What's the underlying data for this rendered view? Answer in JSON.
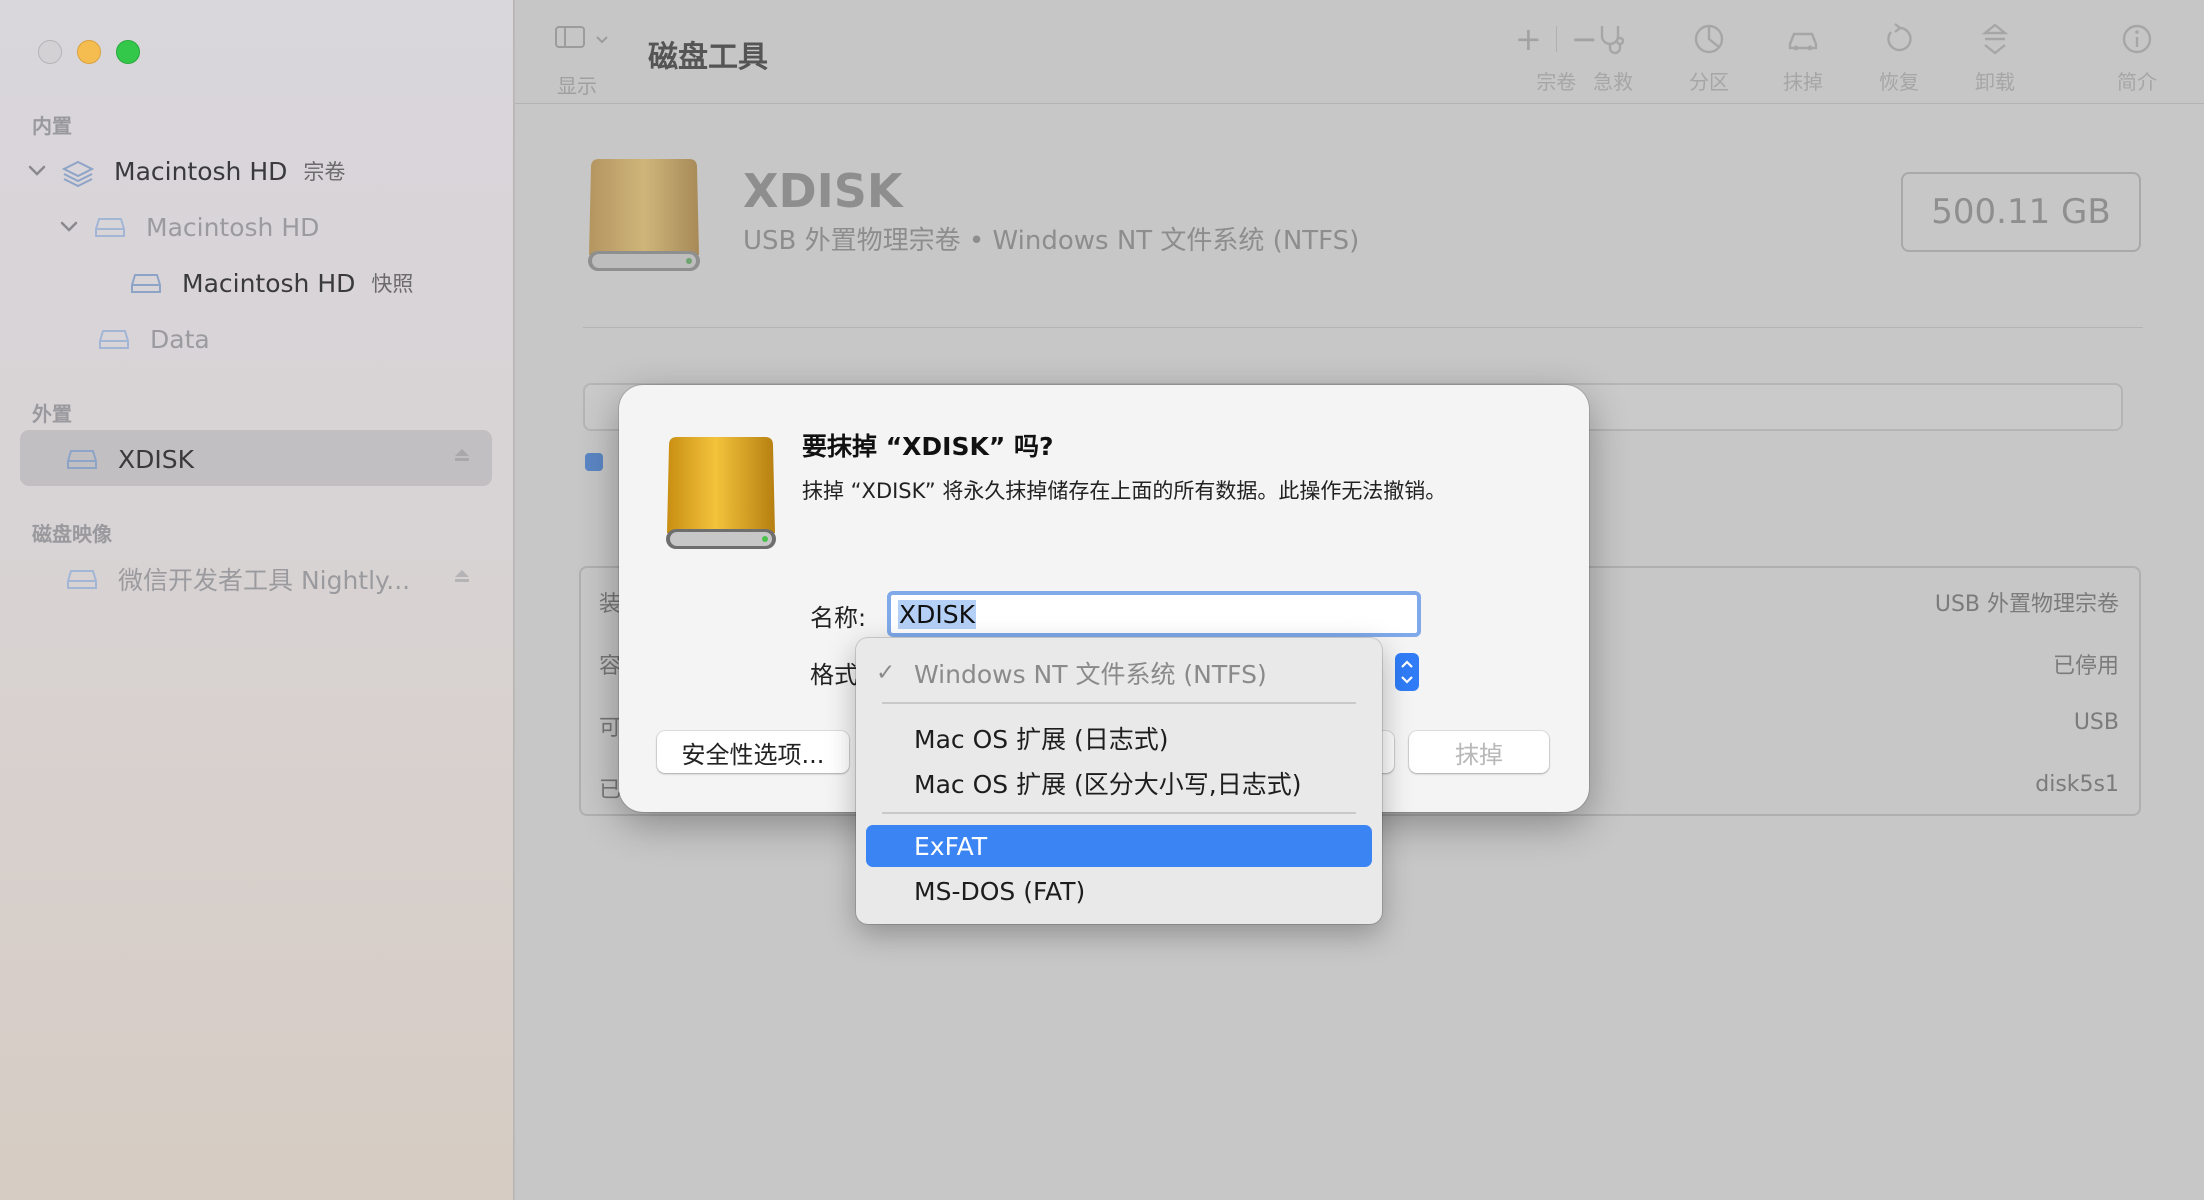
{
  "window": {
    "app_title": "磁盘工具"
  },
  "toolbar": {
    "view_label": "显示",
    "volume_label": "宗卷",
    "first_aid_label": "急救",
    "partition_label": "分区",
    "erase_label": "抹掉",
    "restore_label": "恢复",
    "unmount_label": "卸载",
    "info_label": "简介",
    "add_glyph": "+",
    "remove_glyph": "−"
  },
  "sidebar": {
    "internal_title": "内置",
    "external_title": "外置",
    "images_title": "磁盘映像",
    "items": [
      {
        "label": "Macintosh HD",
        "suffix": "宗卷"
      },
      {
        "label": "Macintosh HD",
        "suffix": ""
      },
      {
        "label": "Macintosh HD",
        "suffix": "快照"
      },
      {
        "label": "Data",
        "suffix": ""
      },
      {
        "label": "XDISK",
        "suffix": ""
      },
      {
        "label": "微信开发者工具 Nightly...",
        "suffix": ""
      }
    ]
  },
  "disk": {
    "name": "XDISK",
    "subtitle": "USB 外置物理宗卷 • Windows NT 文件系统 (NTFS)",
    "capacity": "500.11 GB"
  },
  "info_table": {
    "rows": [
      {
        "key": "装",
        "value": "USB 外置物理宗卷"
      },
      {
        "key": "容",
        "value": "已停用"
      },
      {
        "key": "可",
        "value": "USB"
      },
      {
        "key": "已",
        "value": "disk5s1"
      }
    ]
  },
  "dialog": {
    "title": "要抹掉 “XDISK” 吗?",
    "message": "抹掉 “XDISK” 将永久抹掉储存在上面的所有数据。此操作无法撤销。",
    "name_label": "名称:",
    "name_value": "XDISK",
    "format_label": "格式",
    "security_button": "安全性选项...",
    "erase_button": "抹掉"
  },
  "format_menu": {
    "check_glyph": "✓",
    "items": [
      {
        "label": "Windows NT 文件系统 (NTFS)",
        "state": "checked"
      },
      {
        "label": "Mac OS 扩展 (日志式)",
        "state": "normal"
      },
      {
        "label": "Mac OS 扩展 (区分大小写,日志式)",
        "state": "normal"
      },
      {
        "label": "ExFAT",
        "state": "highlighted"
      },
      {
        "label": "MS-DOS (FAT)",
        "state": "normal"
      }
    ]
  },
  "colors": {
    "accent": "#3b84f4",
    "disk_gold": "#e0ad2c",
    "traffic_min": "#f5bd4f",
    "traffic_max": "#34c84a"
  }
}
